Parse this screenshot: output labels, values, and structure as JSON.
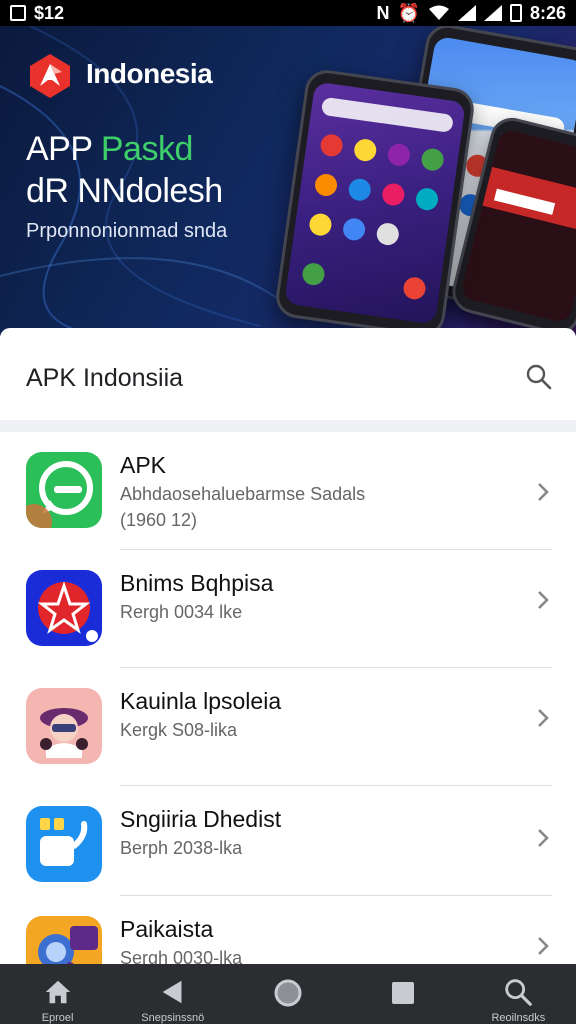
{
  "status_bar": {
    "left_text": "$12",
    "time": "8:26"
  },
  "hero": {
    "brand": "Indonesia",
    "title_line1_white": "APP ",
    "title_line1_green": "Paskd",
    "title_line2": "dR NNdolesh",
    "subtitle": "Prponnonionmad snda"
  },
  "header": {
    "title": "APK Indonsiia",
    "search_icon": "search-icon"
  },
  "apps": [
    {
      "title": "APK",
      "subtitle": "Abhdaosehaluebarmse Sadals",
      "subtitle2": "(1960 12)",
      "icon": "chat-bubble-icon",
      "icon_color": "#2bbf5a"
    },
    {
      "title": "Bnims Bqhpisa",
      "subtitle": "Rergh 0034 lke",
      "subtitle2": "",
      "icon": "star-shield-icon",
      "icon_color": "#1a2bd8"
    },
    {
      "title": "Kauinla lpsoleia",
      "subtitle": "Kergk S08-lika",
      "subtitle2": "",
      "icon": "character-icon",
      "icon_color": "#f4b6b0"
    },
    {
      "title": "Sngiiria Dhedist",
      "subtitle": "Berph 2038-lka",
      "subtitle2": "",
      "icon": "wallet-icon",
      "icon_color": "#1e90ee"
    },
    {
      "title": "Paikaista",
      "subtitle": "Sergh 0030-lka",
      "subtitle2": "",
      "icon": "magnifier-app-icon",
      "icon_color": "#f2a623"
    }
  ],
  "nav": [
    {
      "label": "Eproel",
      "icon": "home-icon"
    },
    {
      "label": "Snepsinssnö",
      "icon": "back-icon"
    },
    {
      "label": "",
      "icon": "circle-home-icon"
    },
    {
      "label": "",
      "icon": "square-recents-icon"
    },
    {
      "label": "Reoilnsdks",
      "icon": "search-icon"
    }
  ]
}
